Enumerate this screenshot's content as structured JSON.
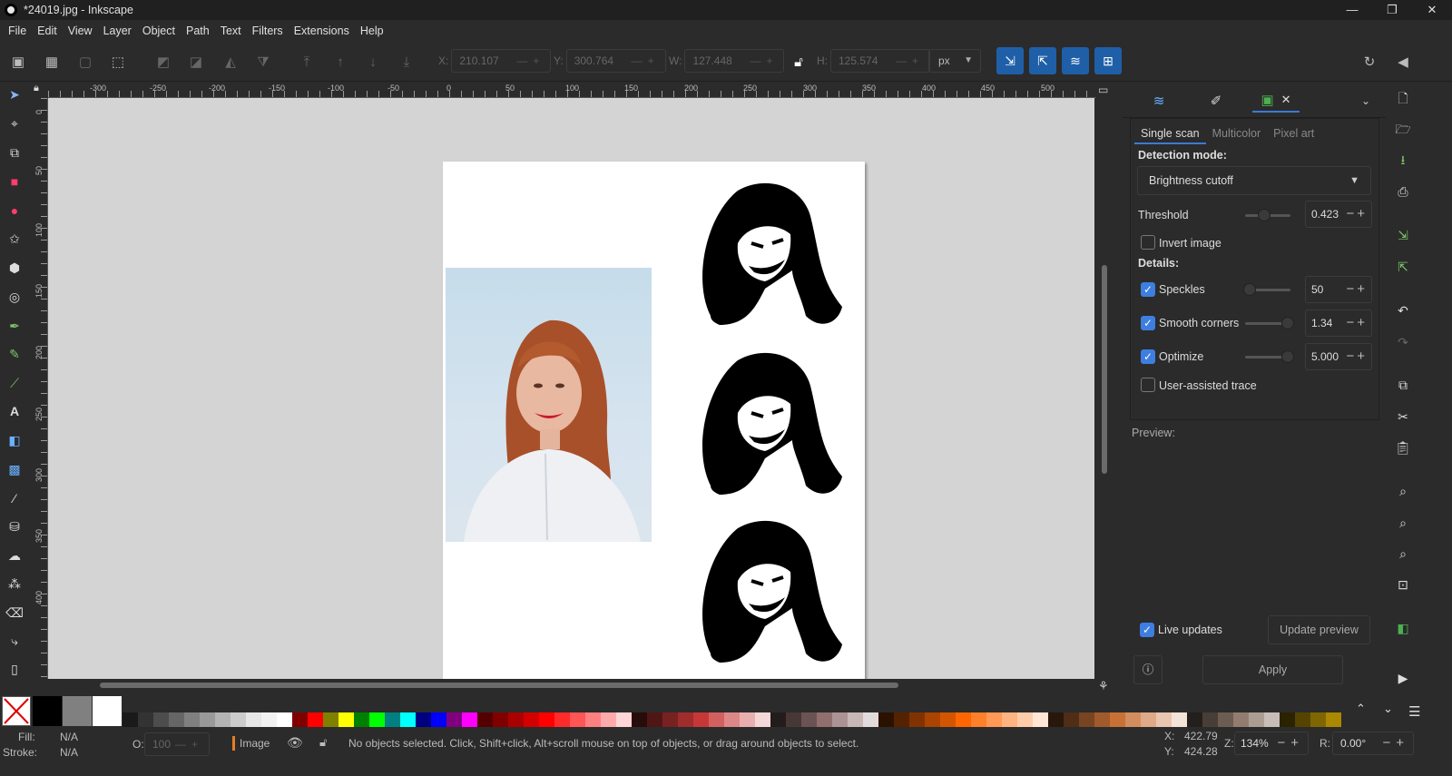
{
  "window": {
    "title": "*24019.jpg - Inkscape",
    "minimize": "—",
    "maximize": "❐",
    "close": "✕"
  },
  "menu": [
    "File",
    "Edit",
    "View",
    "Layer",
    "Object",
    "Path",
    "Text",
    "Filters",
    "Extensions",
    "Help"
  ],
  "toolbar": {
    "x_label": "X:",
    "x_value": "210.107",
    "y_label": "Y:",
    "y_value": "300.764",
    "w_label": "W:",
    "w_value": "127.448",
    "h_label": "H:",
    "h_value": "125.574",
    "unit": "px"
  },
  "ruler_top": [
    "-300",
    "-250",
    "-200",
    "-150",
    "-100",
    "-50",
    "0",
    "50",
    "100",
    "150",
    "200",
    "250",
    "300",
    "350",
    "400",
    "450",
    "500"
  ],
  "ruler_left": [
    "0",
    "50",
    "100",
    "150",
    "200",
    "250",
    "300",
    "350",
    "400"
  ],
  "trace_panel": {
    "subtabs": [
      "Single scan",
      "Multicolor",
      "Pixel art"
    ],
    "detection_label": "Detection mode:",
    "detection_value": "Brightness cutoff",
    "threshold_label": "Threshold",
    "threshold_value": "0.423",
    "invert_label": "Invert image",
    "details_label": "Details:",
    "speckles_label": "Speckles",
    "speckles_value": "50",
    "smooth_label": "Smooth corners",
    "smooth_value": "1.34",
    "optimize_label": "Optimize",
    "optimize_value": "5.000",
    "user_assisted_label": "User-assisted trace",
    "preview_label": "Preview:",
    "live_updates_label": "Live updates",
    "update_preview_label": "Update preview",
    "apply_label": "Apply"
  },
  "status": {
    "fill_label": "Fill:",
    "fill_value": "N/A",
    "stroke_label": "Stroke:",
    "stroke_value": "N/A",
    "opacity_label": "O:",
    "opacity_value": "100",
    "layer": "Image",
    "message": "No objects selected. Click, Shift+click, Alt+scroll mouse on top of objects, or drag around objects to select.",
    "x_label": "X:",
    "x_coord": "422.79",
    "y_label": "Y:",
    "y_coord": "424.28",
    "zoom_label": "Z:",
    "zoom": "134%",
    "rotate_label": "R:",
    "rotation": "0.00°"
  },
  "palette_colors": [
    "#000000",
    "#808080",
    "#ffffff",
    "#1a1a1a",
    "#333333",
    "#4d4d4d",
    "#666666",
    "#808080",
    "#999999",
    "#b3b3b3",
    "#cccccc",
    "#e6e6e6",
    "#f2f2f2",
    "#ffffff",
    "#800000",
    "#ff0000",
    "#808000",
    "#ffff00",
    "#008000",
    "#00ff00",
    "#008080",
    "#00ffff",
    "#000080",
    "#0000ff",
    "#800080",
    "#ff00ff",
    "#550000",
    "#800000",
    "#aa0000",
    "#d40000",
    "#ff0000",
    "#ff2a2a",
    "#ff5555",
    "#ff8080",
    "#ffaaaa",
    "#ffd5d5",
    "#280b0b",
    "#501616",
    "#782121",
    "#a02c2c",
    "#c83737",
    "#d35f5f",
    "#de8787",
    "#e9afaf",
    "#f4d7d7",
    "#241c1c",
    "#483737",
    "#6c5353",
    "#916f6f",
    "#ac9393",
    "#c8b7b7",
    "#e3dbdb",
    "#2b1100",
    "#552200",
    "#803300",
    "#aa4400",
    "#d45500",
    "#ff6600",
    "#ff7f2a",
    "#ff9955",
    "#ffb380",
    "#ffccaa",
    "#ffe6d5",
    "#28170b",
    "#502d16",
    "#784421",
    "#a05a2c",
    "#c87137",
    "#d38d5f",
    "#deaa87",
    "#e9c6af",
    "#f4e3d7",
    "#241f1c",
    "#483e37",
    "#6c5d53",
    "#917c6f",
    "#ac9d93",
    "#c8beb7",
    "#2b2200",
    "#554400",
    "#806600",
    "#aa8800"
  ]
}
